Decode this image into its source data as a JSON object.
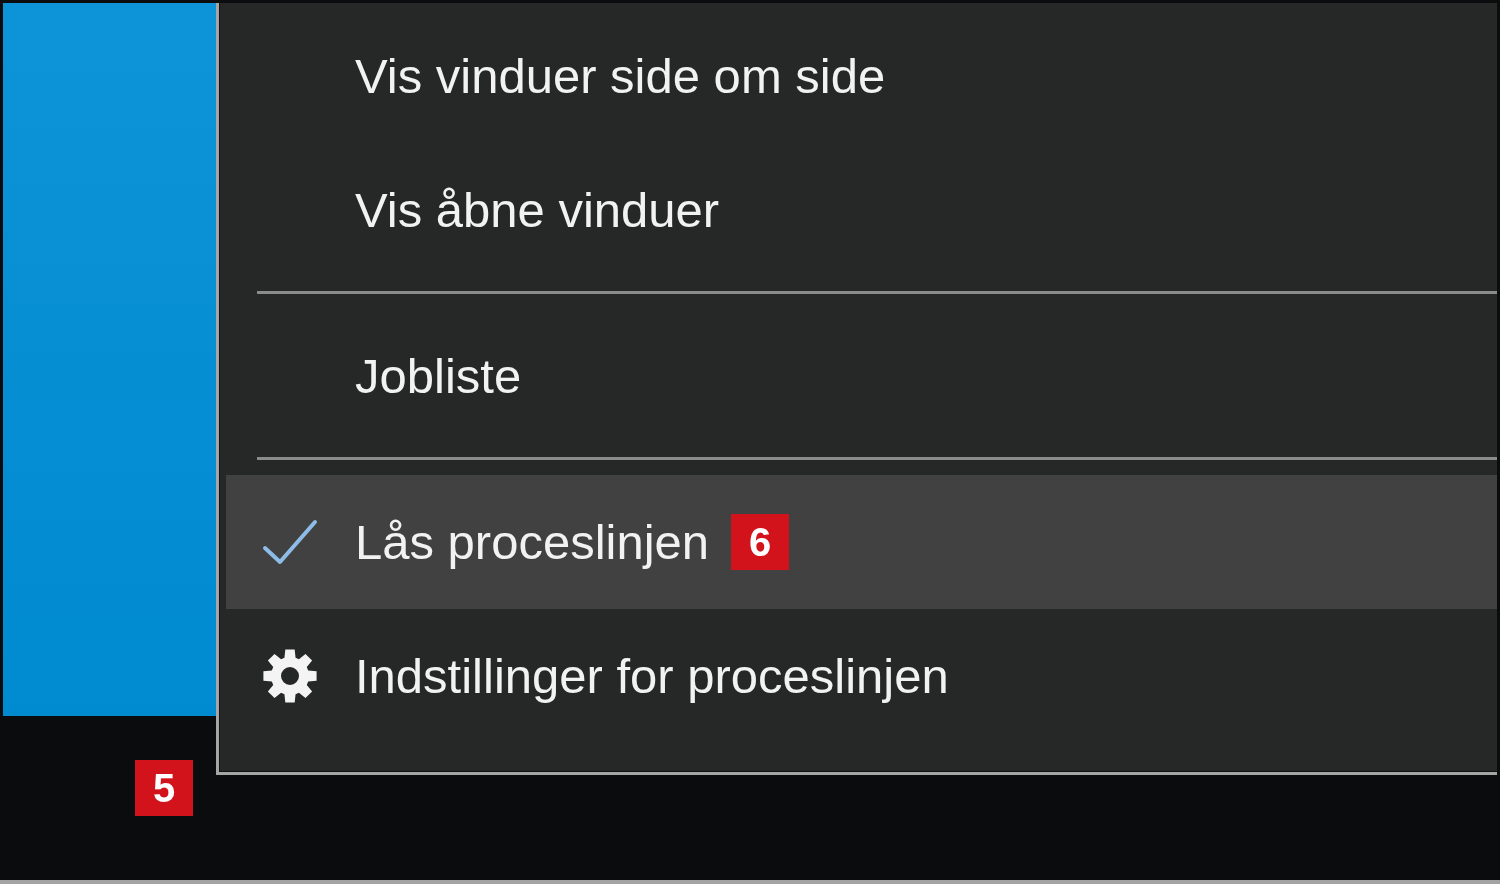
{
  "context_menu": {
    "items": [
      {
        "kind": "command",
        "label": "Vis vinduer side om side",
        "selected": false
      },
      {
        "kind": "command",
        "label": "Vis åbne vinduer",
        "selected": false
      },
      {
        "kind": "separator"
      },
      {
        "kind": "command",
        "label": "Jobliste",
        "selected": false
      },
      {
        "kind": "separator"
      },
      {
        "kind": "toggle",
        "label": "Lås proceslinjen",
        "checked": true,
        "selected": true,
        "callout": "6"
      },
      {
        "kind": "settings",
        "label": "Indstillinger for proceslinjen",
        "selected": false
      }
    ]
  },
  "taskbar": {
    "callout": "5"
  }
}
